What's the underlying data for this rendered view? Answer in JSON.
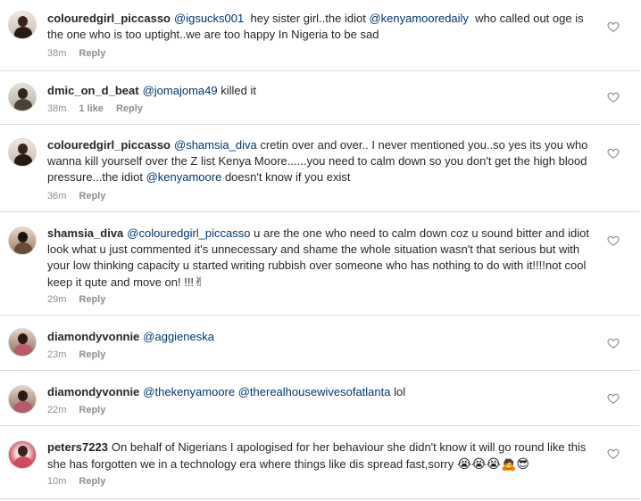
{
  "comments": [
    {
      "user": "colouredgirl_piccasso",
      "mention": "@igsucks001",
      "text1": "hey sister girl..the idiot",
      "mention2": "@kenyamooredaily",
      "text2": "who called out oge is the one who is too uptight..we are too happy In Nigeria to be sad",
      "time": "38m",
      "reply": "Reply"
    },
    {
      "user": "dmic_on_d_beat",
      "mention": "@jomajoma49",
      "text1": "killed it",
      "time": "38m",
      "likes": "1 like",
      "reply": "Reply"
    },
    {
      "user": "colouredgirl_piccasso",
      "mention": "@shamsia_diva",
      "text1": "cretin over and over.. I never mentioned you..so yes its you who wanna kill yourself over the Z list Kenya Moore......you need to calm down so you don't get the high blood pressure...the idiot",
      "mention2": "@kenyamoore",
      "text2": "doesn't know if you exist",
      "time": "36m",
      "reply": "Reply"
    },
    {
      "user": "shamsia_diva",
      "mention": "@colouredgirl_piccasso",
      "text1": "u are the one who need to calm down coz u sound bitter and idiot look what u just commented it's unnecessary and shame the whole situation wasn't that serious but with your low thinking capacity u started writing rubbish  over someone who has nothing to do with it!!!!not cool keep it qute and move on! !!!",
      "emoji": "✌",
      "time": "29m",
      "reply": "Reply"
    },
    {
      "user": "diamondyvonnie",
      "mention": "@aggieneska",
      "time": "23m",
      "reply": "Reply"
    },
    {
      "user": "diamondyvonnie",
      "mention": "@thekenyamoore",
      "mention2": "@therealhousewivesofatlanta",
      "text2": "lol",
      "time": "22m",
      "reply": "Reply"
    },
    {
      "user": "peters7223",
      "text1": "On behalf of Nigerians I apologised for her behaviour she didn't know  it will go round like this she has forgotten we in a technology era where things like dis spread fast,sorry",
      "emoji": "😭😭😭🙇😎",
      "time": "10m",
      "reply": "Reply"
    }
  ],
  "icons": {
    "like": "heart-outline-icon",
    "avatar": "avatar-photo"
  },
  "colors": {
    "mention": "#00376b",
    "meta": "#8e8e8e",
    "divider": "#dbdbdb"
  }
}
